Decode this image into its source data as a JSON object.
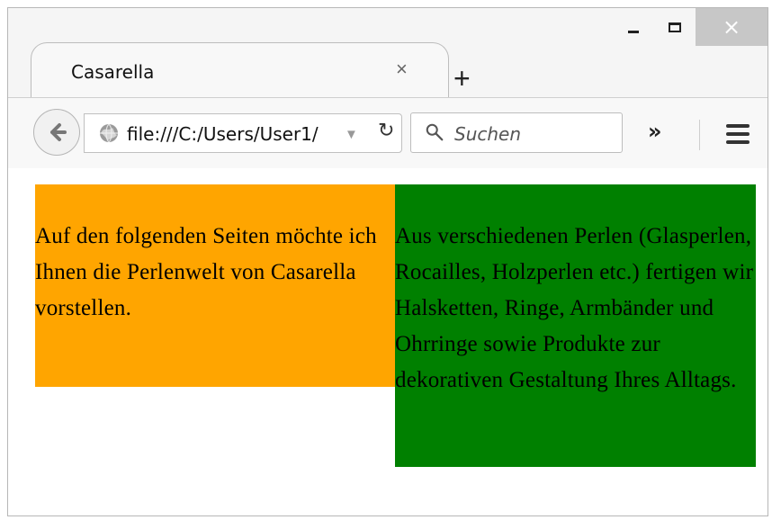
{
  "browser": {
    "tab_title": "Casarella",
    "address": "file:///C:/Users/User1/",
    "search_placeholder": "Suchen",
    "overflow_label": "»"
  },
  "page": {
    "left_text": "Auf den folgenden Seiten möchte ich Ihnen die Perlenwelt von Casarella vorstellen.",
    "right_text": "Aus verschiedenen Perlen (Glasperlen, Rocailles, Holzperlen etc.) fertigen wir Halsketten, Ringe, Armbänder und Ohrringe sowie Produkte zur dekorativen Gestaltung Ihres Alltags."
  },
  "colors": {
    "left_box": "#ffa500",
    "right_box": "#008000"
  },
  "icons": {
    "back": "back-arrow-icon",
    "site": "globe-icon",
    "reload": "reload-icon",
    "search": "search-icon",
    "menu": "hamburger-menu-icon",
    "close": "close-icon",
    "minimize": "minimize-icon",
    "maximize": "maximize-icon",
    "new_tab": "plus-icon",
    "dropdown": "dropdown-arrow-icon"
  }
}
